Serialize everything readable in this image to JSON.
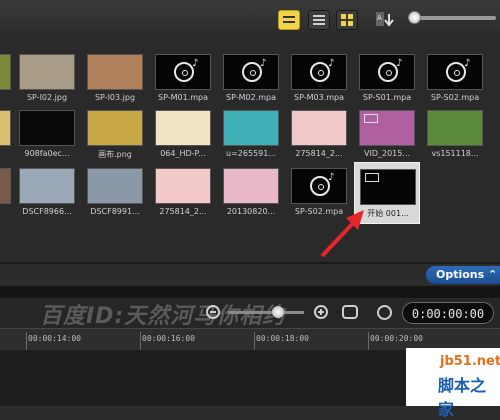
{
  "library": {
    "rows": [
      [
        {
          "caption": "",
          "kind": "image",
          "bg": "#7a8a3a"
        },
        {
          "caption": "SP-I02.jpg",
          "kind": "image",
          "bg": "#a89c86"
        },
        {
          "caption": "SP-I03.jpg",
          "kind": "image",
          "bg": "#b0805a"
        },
        {
          "caption": "SP-M01.mpa",
          "kind": "audio"
        },
        {
          "caption": "SP-M02.mpa",
          "kind": "audio"
        },
        {
          "caption": "SP-M03.mpa",
          "kind": "audio"
        },
        {
          "caption": "SP-S01.mpa",
          "kind": "audio"
        },
        {
          "caption": "SP-S02.mpa",
          "kind": "audio"
        }
      ],
      [
        {
          "caption": "",
          "kind": "image",
          "bg": "#d8c070"
        },
        {
          "caption": "908fa0ec...",
          "kind": "image",
          "bg": "#0a0a0a"
        },
        {
          "caption": "画布.png",
          "kind": "image",
          "bg": "#c9a848"
        },
        {
          "caption": "064_HD-P...",
          "kind": "image",
          "bg": "#f1e3c4"
        },
        {
          "caption": "u=265591...",
          "kind": "image",
          "bg": "#3fb0b5"
        },
        {
          "caption": "275814_2...",
          "kind": "image",
          "bg": "#f0c8c8"
        },
        {
          "caption": "VID_2015...",
          "kind": "video",
          "bg": "#b060a0"
        },
        {
          "caption": "vs151118...",
          "kind": "image",
          "bg": "#5a8a3a"
        }
      ],
      [
        {
          "caption": "",
          "kind": "image",
          "bg": "#7a5a4a"
        },
        {
          "caption": "DSCF8966...",
          "kind": "image",
          "bg": "#9aa8b8"
        },
        {
          "caption": "DSCF8991...",
          "kind": "image",
          "bg": "#8a98a8"
        },
        {
          "caption": "275814_2...",
          "kind": "image",
          "bg": "#f2c8c8"
        },
        {
          "caption": "20130820...",
          "kind": "image",
          "bg": "#e8b8c8"
        },
        {
          "caption": "SP-S02.mpa",
          "kind": "audio"
        },
        {
          "caption": "开始 001...",
          "kind": "video",
          "bg": "#050505",
          "selected": true
        }
      ]
    ]
  },
  "options_label": "Options",
  "watermark": "百度ID:天然河马你相约",
  "timecode": "0:00:00:00",
  "ruler_ticks": [
    "00:00:14:00",
    "00:00:16:00",
    "00:00:18:00",
    "00:00:20:00"
  ],
  "logo": {
    "line1": "jb51.net",
    "line2": "脚本之家"
  },
  "colors": {
    "accent": "#f1d44a",
    "options": "#2f6bb8",
    "arrow": "#e8262a"
  },
  "icons": [
    "view-storyboard-icon",
    "view-list-icon",
    "view-thumbnail-icon",
    "sort-icon",
    "zoom-out-icon",
    "zoom-in-icon",
    "fit-project-icon",
    "clock-icon"
  ]
}
